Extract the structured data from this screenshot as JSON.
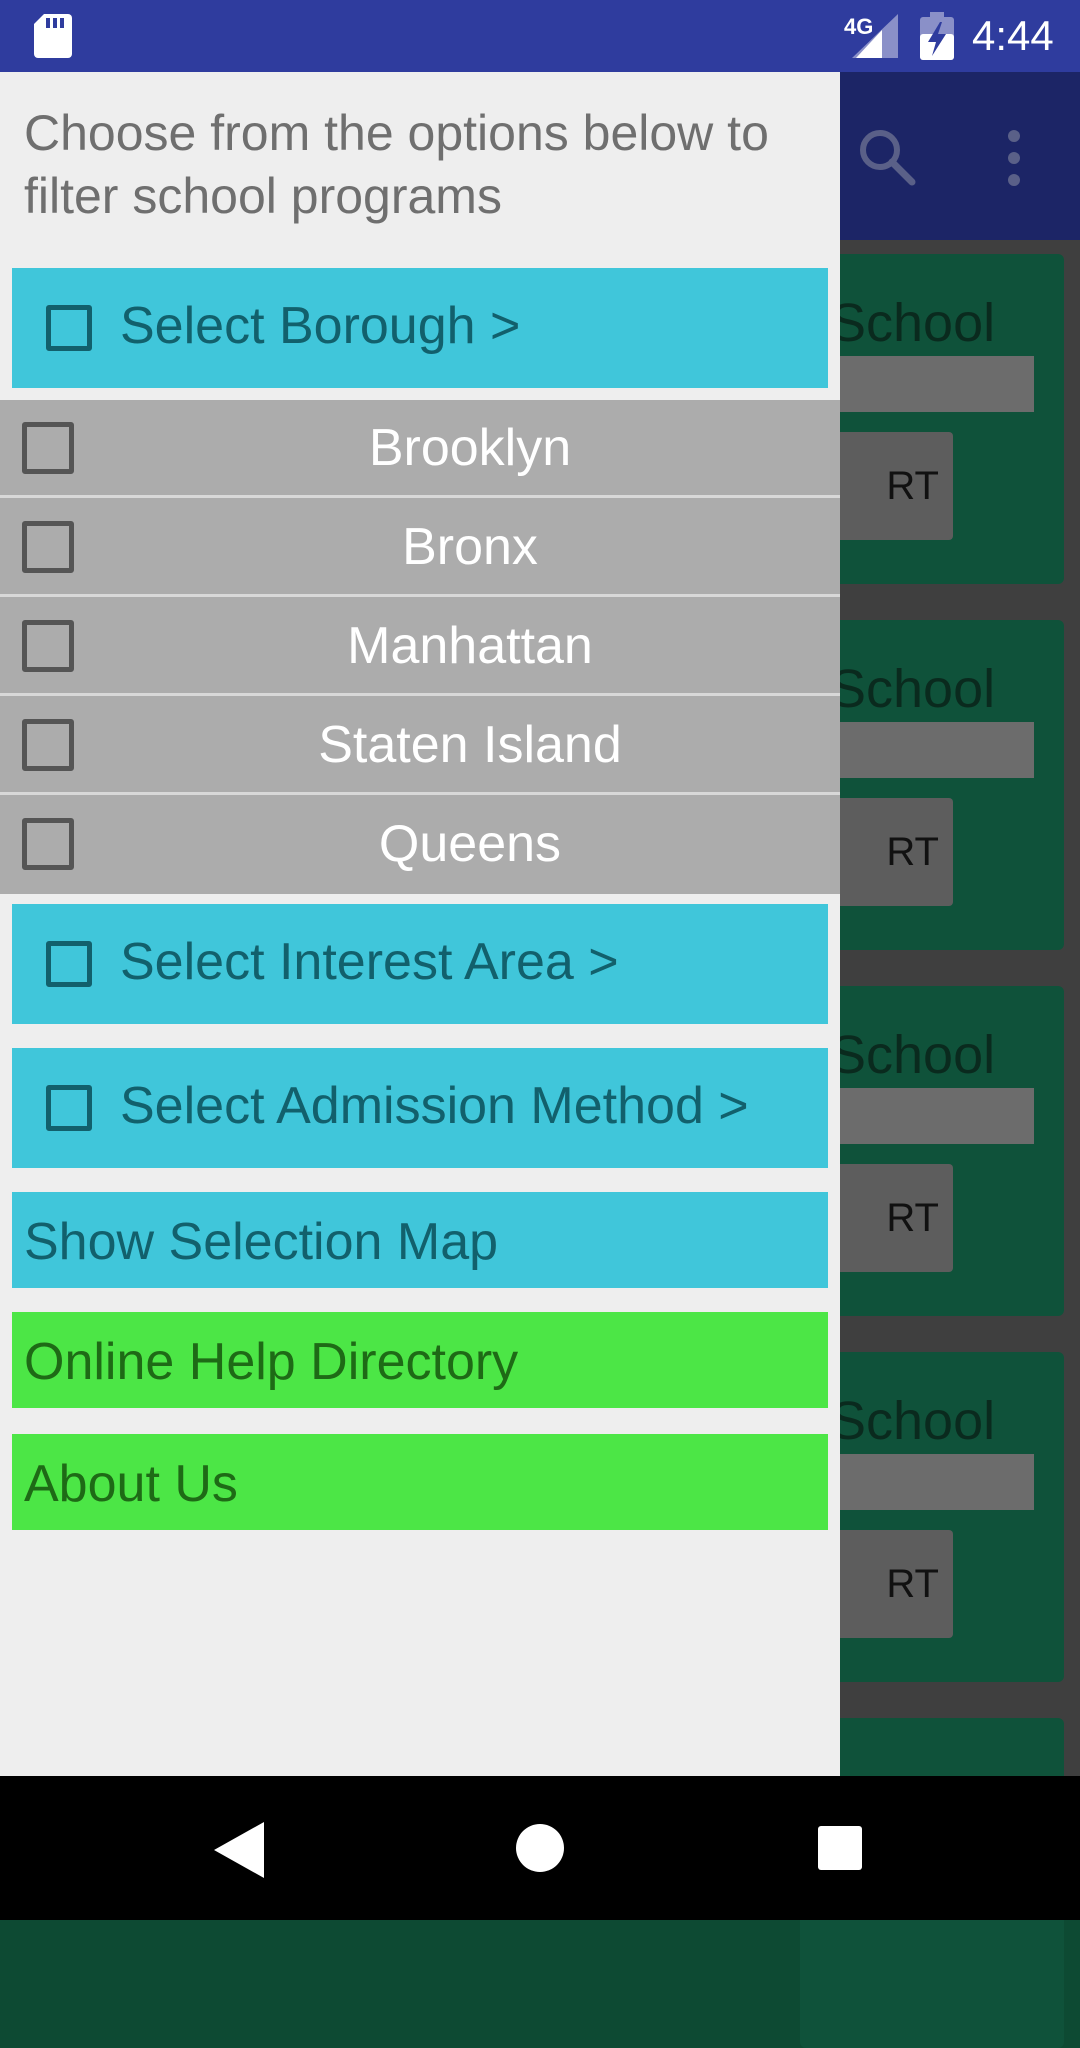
{
  "status_bar": {
    "network": "4G",
    "time": "4:44",
    "icons": [
      "sd-card-icon",
      "signal-icon",
      "battery-charging-icon"
    ]
  },
  "background_app": {
    "cards": [
      {
        "title": "School",
        "button": "RT"
      },
      {
        "title": "School",
        "button": "RT"
      },
      {
        "title": "School",
        "button": "RT"
      },
      {
        "title": "School",
        "button": "RT"
      }
    ],
    "icons": [
      "search-icon",
      "overflow-menu-icon"
    ]
  },
  "drawer": {
    "intro": "Choose from the options below to filter school programs",
    "borough_header": "Select Borough >",
    "boroughs": [
      "Brooklyn",
      "Bronx",
      "Manhattan",
      "Staten Island",
      "Queens"
    ],
    "interest_header": "Select Interest Area >",
    "admission_header": "Select Admission Method >",
    "show_map": "Show Selection Map",
    "help": "Online Help Directory",
    "about": "About Us"
  },
  "nav_bar": {
    "icons": [
      "back-icon",
      "home-icon",
      "recent-apps-icon"
    ]
  },
  "colors": {
    "status_bar": "#2f3c9e",
    "app_bar": "#1c2566",
    "cyan": "#40c6da",
    "green": "#4ce646",
    "gray_list": "#acacac",
    "card": "#0f523a"
  }
}
